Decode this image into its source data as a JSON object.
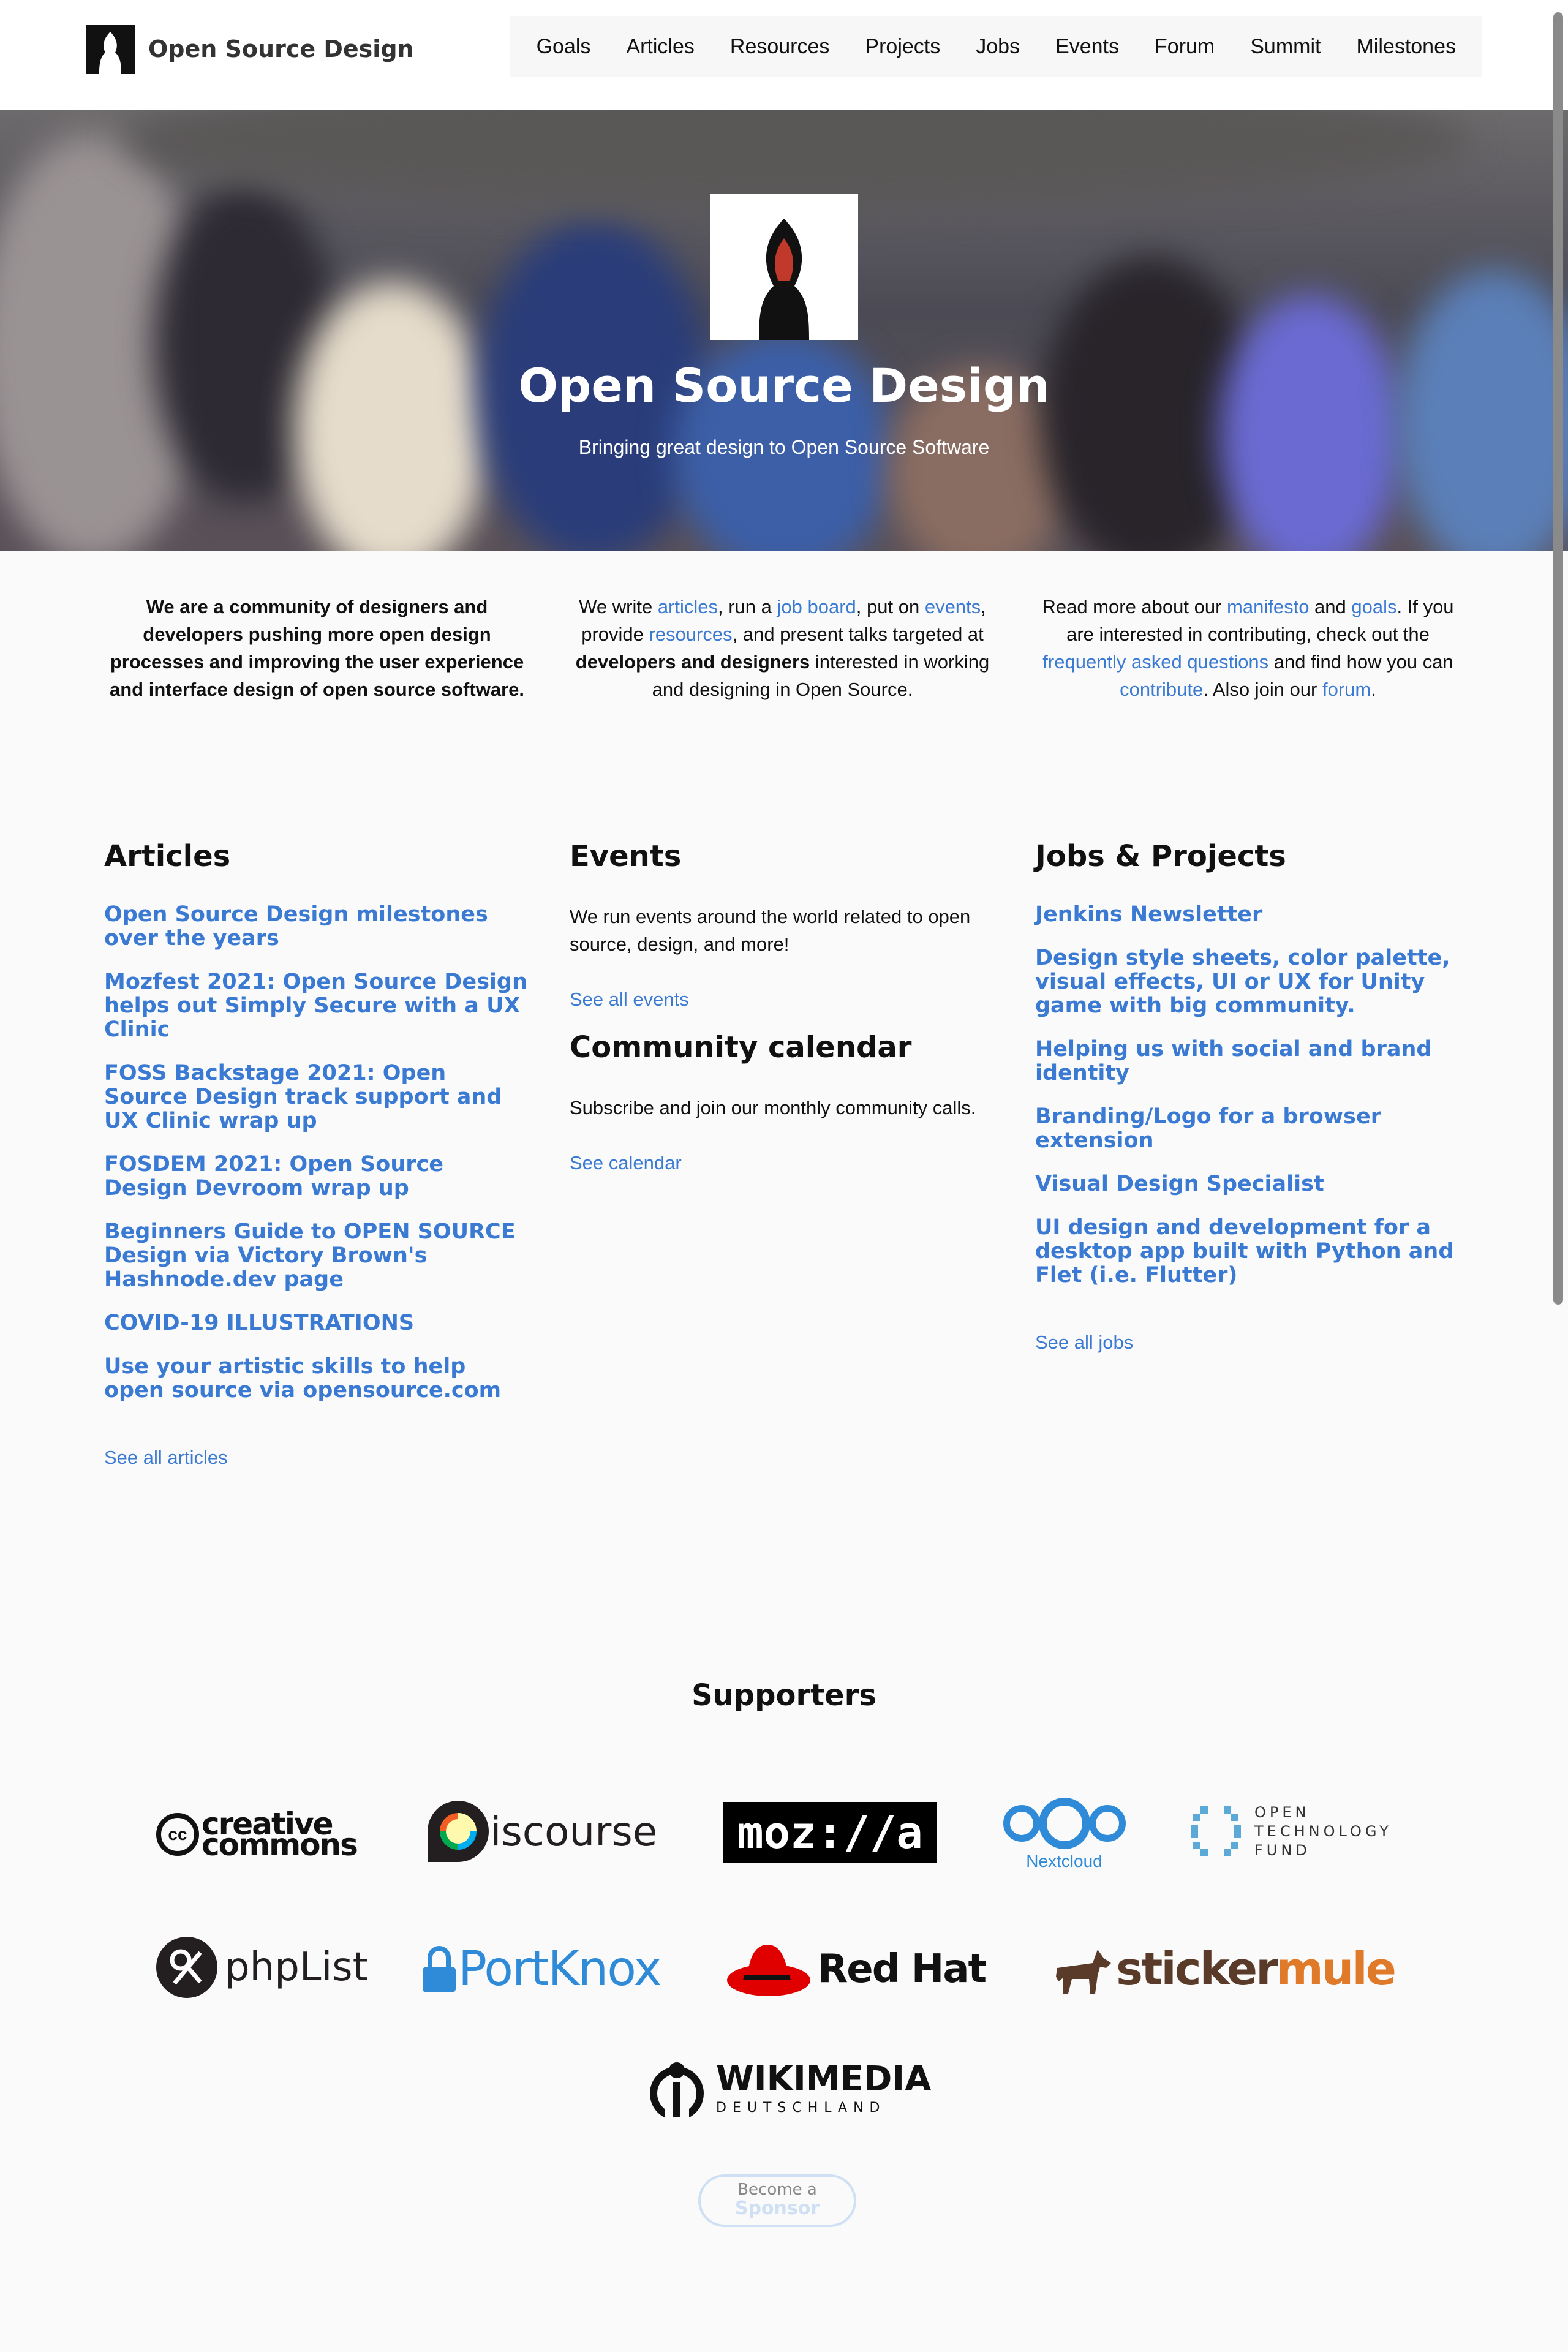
{
  "header": {
    "brand": "Open Source Design",
    "nav": [
      "Goals",
      "Articles",
      "Resources",
      "Projects",
      "Jobs",
      "Events",
      "Forum",
      "Summit",
      "Milestones"
    ]
  },
  "hero": {
    "title": "Open Source Design",
    "subtitle": "Bringing great design to Open Source Software"
  },
  "intro": {
    "col1": "We are a community of designers and developers pushing more open design processes and improving the user experience and interface design of open source software.",
    "col2": {
      "p1": "We write ",
      "l1": "articles",
      "p2": ", run a ",
      "l2": "job board",
      "p3": ", put on ",
      "l3": "events",
      "p4": ", provide ",
      "l4": "resources",
      "p5": ", and present talks targeted at ",
      "b1": "developers and designers",
      "p6": " interested in working and designing in Open Source."
    },
    "col3": {
      "p1": "Read more about our ",
      "l1": "manifesto",
      "p2": " and ",
      "l2": "goals",
      "p3": ". If you are interested in contributing, check out the ",
      "l3": "frequently asked questions",
      "p4": " and find how you can ",
      "l4": "contribute",
      "p5": ". Also join our ",
      "l5": "forum",
      "p6": "."
    }
  },
  "articles": {
    "title": "Articles",
    "items": [
      "Open Source Design milestones over the years",
      "Mozfest 2021: Open Source Design helps out Simply Secure with a UX Clinic",
      "FOSS Backstage 2021: Open Source Design track support and UX Clinic wrap up",
      "FOSDEM 2021: Open Source Design Devroom wrap up",
      "Beginners Guide to OPEN SOURCE Design via Victory Brown's Hashnode.dev page",
      "COVID-19 ILLUSTRATIONS",
      "Use your artistic skills to help open source via opensource.com"
    ],
    "more": "See all articles"
  },
  "events": {
    "title": "Events",
    "text": "We run events around the world related to open source, design, and more!",
    "more": "See all events"
  },
  "calendar": {
    "title": "Community calendar",
    "text": "Subscribe and join our monthly community calls.",
    "more": "See calendar"
  },
  "jobs": {
    "title": "Jobs & Projects",
    "items": [
      "Jenkins Newsletter",
      "Design style sheets, color palette, visual effects, UI or UX for Unity game with big community.",
      "Helping us with social and brand identity",
      "Branding/Logo for a browser extension",
      "Visual Design Specialist",
      "UI design and development for a desktop app built with Python and Flet (i.e. Flutter)"
    ],
    "more": "See all jobs"
  },
  "supporters": {
    "title": "Supporters",
    "cc_line1": "creative",
    "cc_line2": "commons",
    "cc_badge": "cc",
    "discourse": "iscourse",
    "mozilla": "moz://a",
    "nextcloud": "Nextcloud",
    "otf_line1": "OPEN",
    "otf_line2": "TECHNOLOGY",
    "otf_line3": "FUND",
    "phplist": "phpList",
    "portknox": "PortKnox",
    "redhat": "Red Hat",
    "sticker": "sticker",
    "mule": "mule",
    "wikimedia": "WIKIMEDIA",
    "deutschland": "DEUTSCHLAND"
  },
  "sponsor": {
    "line1": "Become a",
    "line2": "Sponsor"
  },
  "colors": {
    "link": "#3b7ad3",
    "text": "#111111",
    "nextcloud": "#2f8bd8",
    "redhat": "#e00000",
    "mule": "#e07a2b"
  }
}
